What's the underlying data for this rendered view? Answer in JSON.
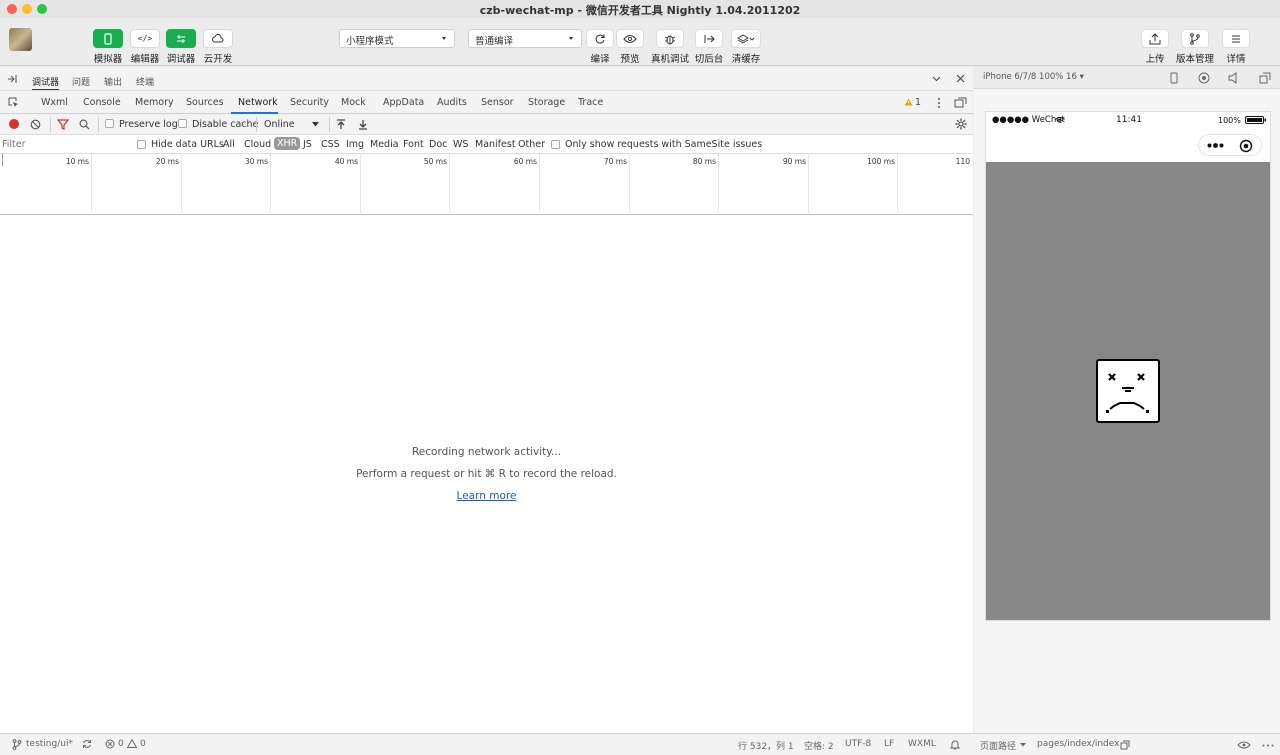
{
  "window": {
    "title": "czb-wechat-mp - 微信开发者工具 Nightly 1.04.2011202"
  },
  "toolbar": {
    "simulator_label": "模拟器",
    "editor_label": "编辑器",
    "debugger_label": "调试器",
    "cloud_label": "云开发",
    "mode_select": "小程序模式",
    "compile_select": "普通编译",
    "compile_label": "编译",
    "preview_label": "预览",
    "remote_debug_label": "真机调试",
    "background_label": "切后台",
    "clear_cache_label": "清缓存",
    "upload_label": "上传",
    "version_label": "版本管理",
    "details_label": "详情"
  },
  "devtools": {
    "subtabs": [
      "调试器",
      "问题",
      "输出",
      "终端"
    ],
    "panel_tabs": [
      "Wxml",
      "Console",
      "Memory",
      "Sources",
      "Network",
      "Security",
      "Mock",
      "AppData",
      "Audits",
      "Sensor",
      "Storage",
      "Trace"
    ],
    "warning_count": "1",
    "network": {
      "preserve_log": "Preserve log",
      "disable_cache": "Disable cache",
      "throttle": "Online",
      "filter_placeholder": "Filter",
      "hide_data_urls": "Hide data URLs",
      "types": [
        "All",
        "Cloud",
        "XHR",
        "JS",
        "CSS",
        "Img",
        "Media",
        "Font",
        "Doc",
        "WS",
        "Manifest",
        "Other"
      ],
      "same_site": "Only show requests with SameSite issues",
      "timeline_ticks": [
        "10 ms",
        "20 ms",
        "30 ms",
        "40 ms",
        "50 ms",
        "60 ms",
        "70 ms",
        "80 ms",
        "90 ms",
        "100 ms",
        "110"
      ],
      "recording": "Recording network activity...",
      "hint": "Perform a request or hit ⌘ R to record the reload.",
      "learn_more": "Learn more"
    }
  },
  "simulator": {
    "device": "iPhone 6/7/8 100% 16 ▾",
    "carrier": "●●●●● WeChat",
    "time": "11:41",
    "battery": "100%"
  },
  "statusbar": {
    "branch": "testing/ui*",
    "errors": "0",
    "warnings": "0",
    "position": "行 532，列 1",
    "spaces": "空格: 2",
    "encoding": "UTF-8",
    "eol": "LF",
    "language": "WXML",
    "page_path_label": "页面路径",
    "page_path": "pages/index/index"
  },
  "colors": {
    "accent_green": "#1aad50",
    "link_blue": "#1a5fc9",
    "tab_underline": "#1a73e8",
    "sim_background": "#888888"
  }
}
